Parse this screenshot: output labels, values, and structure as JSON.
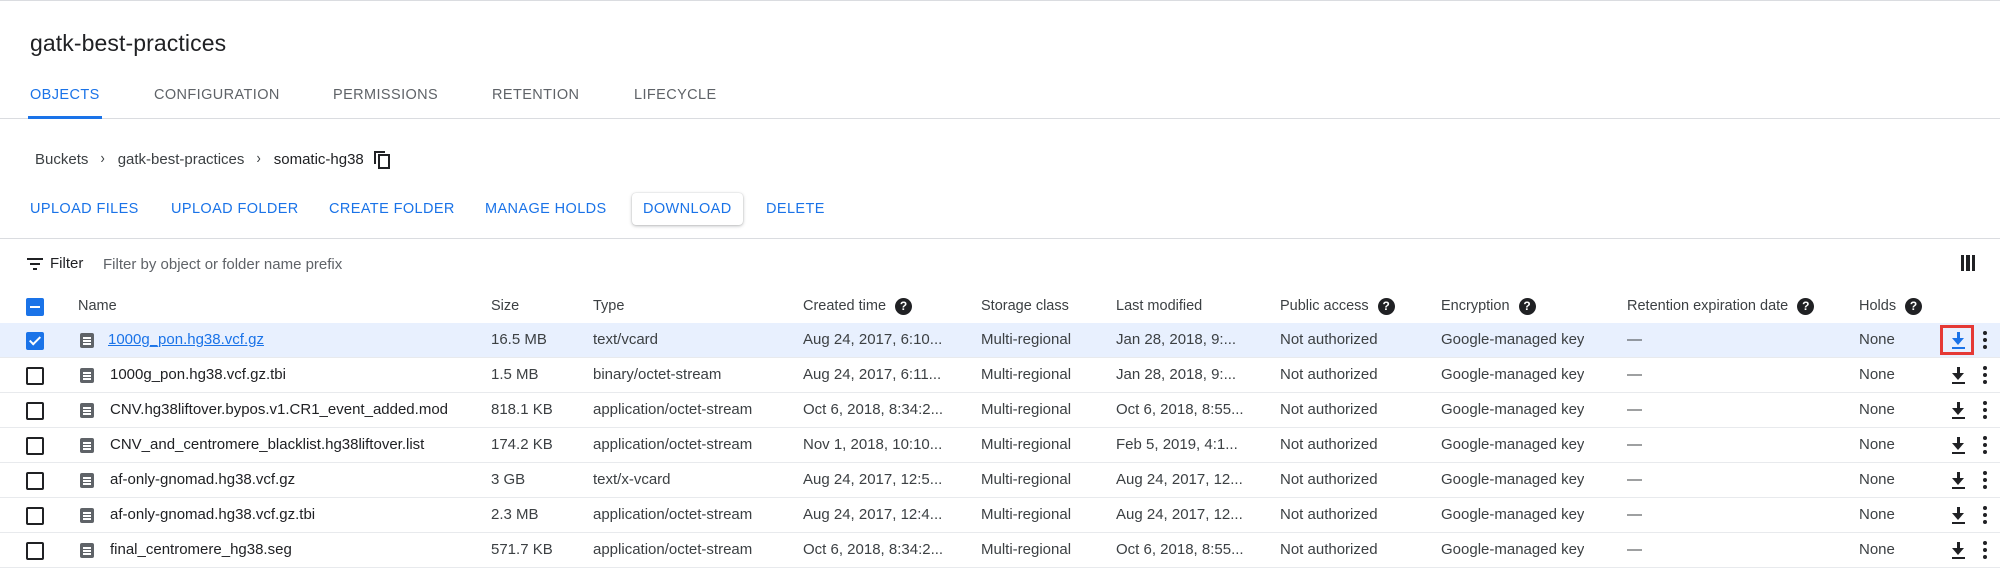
{
  "bucket_title": "gatk-best-practices",
  "tabs": [
    {
      "label": "OBJECTS",
      "active": true
    },
    {
      "label": "CONFIGURATION",
      "active": false
    },
    {
      "label": "PERMISSIONS",
      "active": false
    },
    {
      "label": "RETENTION",
      "active": false
    },
    {
      "label": "LIFECYCLE",
      "active": false
    }
  ],
  "breadcrumb": {
    "items": [
      "Buckets",
      "gatk-best-practices",
      "somatic-hg38"
    ],
    "separator": "›",
    "copy_icon": "copy-icon"
  },
  "actions": {
    "upload_files": "UPLOAD FILES",
    "upload_folder": "UPLOAD FOLDER",
    "create_folder": "CREATE FOLDER",
    "manage_holds": "MANAGE HOLDS",
    "download": "DOWNLOAD",
    "delete": "DELETE"
  },
  "filter": {
    "label": "Filter",
    "placeholder": "Filter by object or folder name prefix",
    "value": "",
    "icon": "filter-list-icon",
    "columns_icon": "view-column-icon"
  },
  "table": {
    "headers": {
      "name": "Name",
      "size": "Size",
      "type": "Type",
      "created": "Created time",
      "storage": "Storage class",
      "modified": "Last modified",
      "public": "Public access",
      "encryption": "Encryption",
      "retention": "Retention expiration date",
      "holds": "Holds"
    },
    "help_glyph": "?",
    "rows": [
      {
        "name": "1000g_pon.hg38.vcf.gz",
        "size": "16.5 MB",
        "type": "text/vcard",
        "created": "Aug 24, 2017, 6:10...",
        "storage": "Multi-regional",
        "modified": "Jan 28, 2018, 9:...",
        "public": "Not authorized",
        "encryption": "Google-managed key",
        "retention": "—",
        "holds": "None",
        "selected": true
      },
      {
        "name": "1000g_pon.hg38.vcf.gz.tbi",
        "size": "1.5 MB",
        "type": "binary/octet-stream",
        "created": "Aug 24, 2017, 6:11...",
        "storage": "Multi-regional",
        "modified": "Jan 28, 2018, 9:...",
        "public": "Not authorized",
        "encryption": "Google-managed key",
        "retention": "—",
        "holds": "None",
        "selected": false
      },
      {
        "name": "CNV.hg38liftover.bypos.v1.CR1_event_added.mod",
        "size": "818.1 KB",
        "type": "application/octet-stream",
        "created": "Oct 6, 2018, 8:34:2...",
        "storage": "Multi-regional",
        "modified": "Oct 6, 2018, 8:55...",
        "public": "Not authorized",
        "encryption": "Google-managed key",
        "retention": "—",
        "holds": "None",
        "selected": false
      },
      {
        "name": "CNV_and_centromere_blacklist.hg38liftover.list",
        "size": "174.2 KB",
        "type": "application/octet-stream",
        "created": "Nov 1, 2018, 10:10...",
        "storage": "Multi-regional",
        "modified": "Feb 5, 2019, 4:1...",
        "public": "Not authorized",
        "encryption": "Google-managed key",
        "retention": "—",
        "holds": "None",
        "selected": false
      },
      {
        "name": "af-only-gnomad.hg38.vcf.gz",
        "size": "3 GB",
        "type": "text/x-vcard",
        "created": "Aug 24, 2017, 12:5...",
        "storage": "Multi-regional",
        "modified": "Aug 24, 2017, 12...",
        "public": "Not authorized",
        "encryption": "Google-managed key",
        "retention": "—",
        "holds": "None",
        "selected": false
      },
      {
        "name": "af-only-gnomad.hg38.vcf.gz.tbi",
        "size": "2.3 MB",
        "type": "application/octet-stream",
        "created": "Aug 24, 2017, 12:4...",
        "storage": "Multi-regional",
        "modified": "Aug 24, 2017, 12...",
        "public": "Not authorized",
        "encryption": "Google-managed key",
        "retention": "—",
        "holds": "None",
        "selected": false
      },
      {
        "name": "final_centromere_hg38.seg",
        "size": "571.7 KB",
        "type": "application/octet-stream",
        "created": "Oct 6, 2018, 8:34:2...",
        "storage": "Multi-regional",
        "modified": "Oct 6, 2018, 8:55...",
        "public": "Not authorized",
        "encryption": "Google-managed key",
        "retention": "—",
        "holds": "None",
        "selected": false
      }
    ],
    "row_icons": {
      "file": "file-icon",
      "download": "download-icon",
      "more": "more-vert-icon"
    }
  },
  "colors": {
    "accent": "#1a73e8",
    "highlight": "#e53935",
    "selected_row": "#e8f0fe"
  }
}
